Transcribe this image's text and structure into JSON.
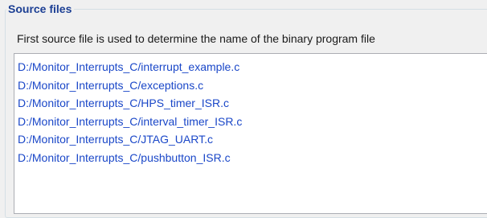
{
  "source_files": {
    "title": "Source files",
    "description": "First source file is used to determine the name of the binary program file",
    "files": [
      "D:/Monitor_Interrupts_C/interrupt_example.c",
      "D:/Monitor_Interrupts_C/exceptions.c",
      "D:/Monitor_Interrupts_C/HPS_timer_ISR.c",
      "D:/Monitor_Interrupts_C/interval_timer_ISR.c",
      "D:/Monitor_Interrupts_C/JTAG_UART.c",
      "D:/Monitor_Interrupts_C/pushbutton_ISR.c"
    ]
  },
  "colors": {
    "title": "#1c3f94",
    "file_text": "#1a47c8",
    "list_border": "#abadb3",
    "group_border": "#d5dfe5"
  }
}
